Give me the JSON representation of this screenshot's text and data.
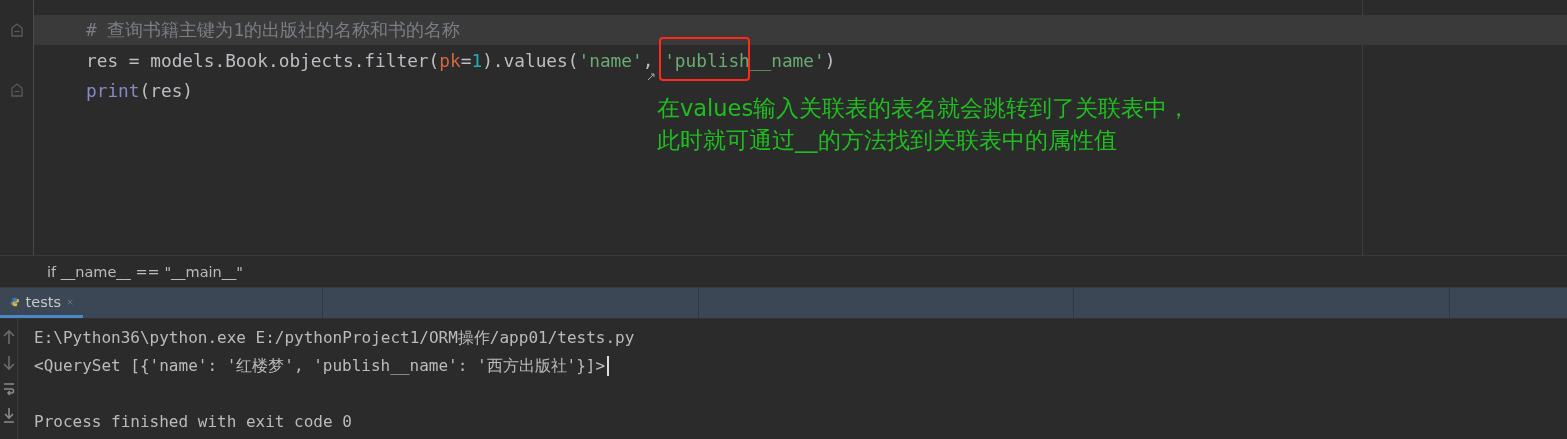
{
  "editor": {
    "lines": [
      {
        "current": true,
        "fold_marker": true,
        "tokens": [
          {
            "kind": "comment",
            "text": "# 查询书籍主键为1的出版社的名称和书的名称"
          }
        ]
      },
      {
        "current": false,
        "fold_marker": false,
        "tokens": [
          {
            "kind": "plain",
            "text": "res = models.Book.objects.filter("
          },
          {
            "kind": "param",
            "text": "pk"
          },
          {
            "kind": "plain",
            "text": "="
          },
          {
            "kind": "number",
            "text": "1"
          },
          {
            "kind": "plain",
            "text": ").values("
          },
          {
            "kind": "string",
            "text": "'name'"
          },
          {
            "kind": "plain",
            "text": ", "
          },
          {
            "kind": "string",
            "text": "'publish__name'"
          },
          {
            "kind": "plain",
            "text": ")"
          }
        ]
      },
      {
        "current": false,
        "fold_marker": true,
        "tokens": [
          {
            "kind": "builtin",
            "text": "print"
          },
          {
            "kind": "plain",
            "text": "(res)"
          }
        ]
      }
    ],
    "annotation": [
      "在values输入关联表的表名就会跳转到了关联表中，",
      "此时就可通过__的方法找到关联表中的属性值"
    ]
  },
  "breadcrumb": "if __name__ == \"__main__\"",
  "run_panel": {
    "tabs": [
      {
        "label": "tests",
        "selected": true
      }
    ],
    "output": [
      "E:\\Python36\\python.exe E:/pythonProject1/ORM操作/app01/tests.py",
      "<QuerySet [{'name': '红楼梦', 'publish__name': '西方出版社'}]>",
      "Process finished with exit code 0"
    ]
  }
}
